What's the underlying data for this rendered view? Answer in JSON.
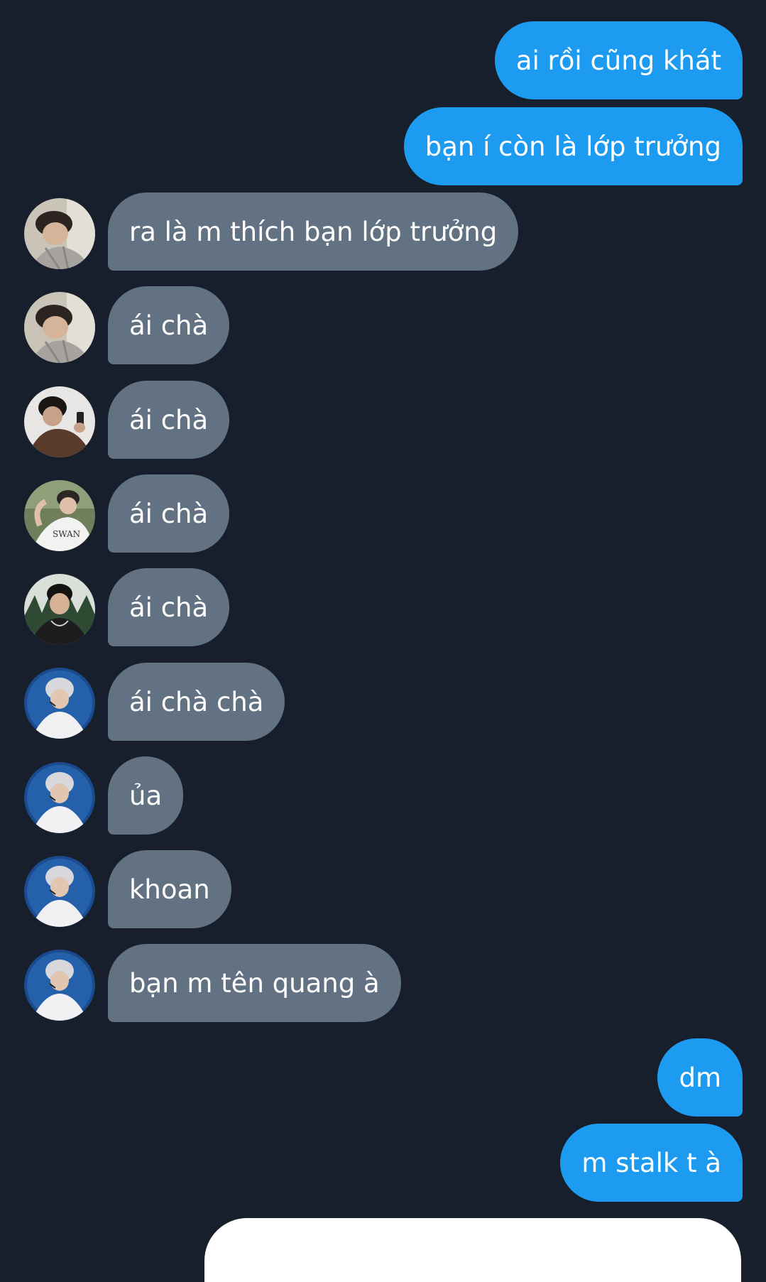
{
  "messages": [
    {
      "dir": "out",
      "text": "ai rồi cũng khát"
    },
    {
      "dir": "out",
      "text": "bạn í còn là lớp trưởng"
    },
    {
      "dir": "in",
      "avatar": "avatar-1-icon",
      "text": "ra là m thích bạn lớp trưởng"
    },
    {
      "dir": "in",
      "avatar": "avatar-1-icon",
      "text": "ái chà"
    },
    {
      "dir": "in",
      "avatar": "avatar-2-icon",
      "text": "ái chà"
    },
    {
      "dir": "in",
      "avatar": "avatar-3-icon",
      "text": "ái chà"
    },
    {
      "dir": "in",
      "avatar": "avatar-4-icon",
      "text": "ái chà"
    },
    {
      "dir": "in",
      "avatar": "avatar-5-icon",
      "text": "ái chà chà"
    },
    {
      "dir": "in",
      "avatar": "avatar-5-icon",
      "text": "ủa"
    },
    {
      "dir": "in",
      "avatar": "avatar-5-icon",
      "text": "khoan"
    },
    {
      "dir": "in",
      "avatar": "avatar-5-icon",
      "text": "bạn m tên quang à"
    },
    {
      "dir": "out",
      "text": "dm"
    },
    {
      "dir": "out",
      "text": "m stalk t à"
    }
  ],
  "colors": {
    "background": "#161f2b",
    "outgoing_bubble": "#1d9bf0",
    "incoming_bubble": "#627282",
    "text": "#ffffff"
  }
}
